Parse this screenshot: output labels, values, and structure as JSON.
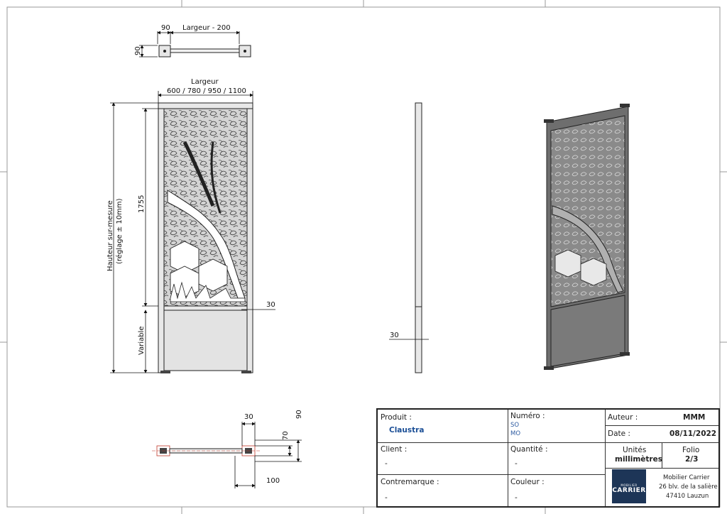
{
  "drawing": {
    "top_view": {
      "dim_90_h": "90",
      "dim_largeur_200": "Largeur - 200",
      "dim_90_v": "90"
    },
    "front_view": {
      "largeur_title": "Largeur",
      "largeur_values": "600 / 780 / 950 / 1100",
      "hauteur_label": "Hauteur sur-mesure",
      "reglage_label": "(réglage ± 10mm)",
      "dim_1755": "1755",
      "dim_variable": "Variable",
      "dim_30": "30"
    },
    "side_view": {
      "dim_30": "30"
    },
    "detail_view": {
      "dim_30": "30",
      "dim_90": "90",
      "dim_70": "70",
      "dim_100": "100"
    }
  },
  "title_block": {
    "produit_label": "Produit :",
    "produit_value": "Claustra",
    "numero_label": "Numéro :",
    "numero_so": "SO",
    "numero_mo": "MO",
    "auteur_label": "Auteur :",
    "auteur_value": "MMM",
    "date_label": "Date :",
    "date_value": "08/11/2022",
    "client_label": "Client :",
    "client_value": "-",
    "quantite_label": "Quantité :",
    "quantite_value": "-",
    "unites_label": "Unités",
    "unites_value": "millimètres",
    "folio_label": "Folio",
    "folio_value": "2/3",
    "contremarque_label": "Contremarque :",
    "contremarque_value": "-",
    "couleur_label": "Couleur :",
    "couleur_value": "-",
    "logo_small": "MOBILIER",
    "logo_big": "CARRIER",
    "company_name": "Mobilier Carrier",
    "company_address": "26 blv. de la salière",
    "company_city": "47410 Lauzun"
  },
  "colors": {
    "accent": "#1b4f96",
    "logo_bg": "#1d3557",
    "frame": "#555555"
  }
}
